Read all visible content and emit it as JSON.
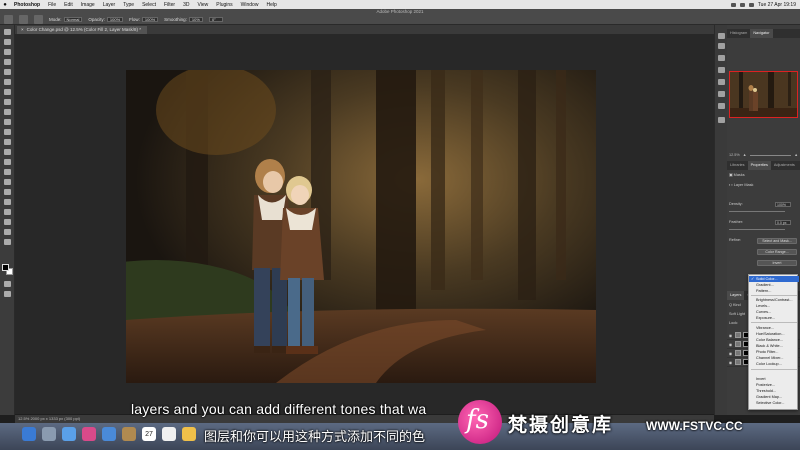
{
  "menubar": {
    "apple": "",
    "app_name": "Photoshop",
    "items": [
      "File",
      "Edit",
      "Image",
      "Layer",
      "Type",
      "Select",
      "Filter",
      "3D",
      "View",
      "Plugins",
      "Window",
      "Help"
    ],
    "clock": "Tue 27 Apr 19:19"
  },
  "optionsbar": {
    "window_title": "Adobe Photoshop 2021",
    "mode_label": "Mode:",
    "mode_value": "Normal",
    "opacity_label": "Opacity:",
    "opacity_value": "100%",
    "flow_label": "Flow:",
    "flow_value": "100%",
    "smoothing_label": "Smoothing:",
    "smoothing_value": "10%",
    "angle_value": "0°"
  },
  "document_tab": {
    "title": "Color Change.psd @ 12.5% (Color Fill 2, Layer Mask/8) *"
  },
  "panels": {
    "top_tabs": [
      "Histogram",
      "Navigator"
    ],
    "zoom": "12.5%",
    "mid_tabs": [
      "Libraries",
      "Properties",
      "Adjustments"
    ],
    "masks_label": "Masks",
    "layer_mask_label": "Layer Mask",
    "density_label": "Density:",
    "density_value": "100%",
    "feather_label": "Feather:",
    "feather_value": "0.0 px",
    "refine_label": "Refine:",
    "select_mask_btn": "Select and Mask...",
    "color_range_btn": "Color Range...",
    "invert_btn": "Invert"
  },
  "layers": {
    "tabs": [
      "Layers",
      "Ch"
    ],
    "kind_label": "Q Kind",
    "blend_mode": "Soft Light",
    "lock_label": "Lock:"
  },
  "fill_menu": {
    "items": [
      {
        "label": "Solid Color...",
        "selected": true
      },
      {
        "label": "Gradient...",
        "selected": false
      },
      {
        "label": "Pattern...",
        "selected": false
      },
      {
        "label": "Brightness/Contrast...",
        "selected": false
      },
      {
        "label": "Levels...",
        "selected": false
      },
      {
        "label": "Curves...",
        "selected": false
      },
      {
        "label": "Exposure...",
        "selected": false
      },
      {
        "label": "Vibrance...",
        "selected": false
      },
      {
        "label": "Hue/Saturation...",
        "selected": false
      },
      {
        "label": "Color Balance...",
        "selected": false
      },
      {
        "label": "Black & White...",
        "selected": false
      },
      {
        "label": "Photo Filter...",
        "selected": false
      },
      {
        "label": "Channel Mixer...",
        "selected": false
      },
      {
        "label": "Color Lookup...",
        "selected": false
      },
      {
        "label": "Invert",
        "selected": false
      },
      {
        "label": "Posterize...",
        "selected": false
      },
      {
        "label": "Threshold...",
        "selected": false
      },
      {
        "label": "Gradient Map...",
        "selected": false
      },
      {
        "label": "Selective Color...",
        "selected": false
      }
    ]
  },
  "statusbar": {
    "text": "12.5%     2000 px x 1333 px (300 ppi)"
  },
  "dock": {
    "calendar_day": "27"
  },
  "subtitles": {
    "english": "layers and you can add different tones that wa",
    "chinese": "图层和你可以用这种方式添加不同的色"
  },
  "watermark": {
    "logo_text": "fs",
    "brand_cn": "梵摄创意库",
    "url": "WWW.FSTVC.CC"
  },
  "colors": {
    "ps_dark": "#282828",
    "ps_panel": "#3c3c3c",
    "highlight_blue": "#2f6ad0",
    "watermark_pink": "#e0308e"
  }
}
